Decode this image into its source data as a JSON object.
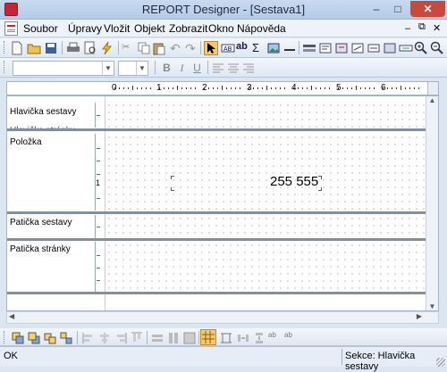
{
  "window": {
    "title": "REPORT Designer - [Sestava1]"
  },
  "menubar": {
    "items": [
      {
        "label": "Soubor"
      },
      {
        "label": "Úpravy"
      },
      {
        "label": "Vložit"
      },
      {
        "label": "Objekt"
      },
      {
        "label": "Zobrazit"
      },
      {
        "label": "Okno"
      },
      {
        "label": "Nápověda"
      }
    ]
  },
  "format_toolbar": {
    "font_value": "",
    "size_value": "",
    "bold": "B",
    "italic": "I",
    "underline": "U"
  },
  "ruler": {
    "numbers": [
      "0",
      "1",
      "2",
      "3",
      "4",
      "5",
      "6"
    ]
  },
  "bands": [
    {
      "label": "Hlavička sestavy"
    },
    {
      "label": "Položka"
    },
    {
      "label": "Patička sestavy"
    },
    {
      "label": "Patička stránky"
    }
  ],
  "band_cut_label": "Hlavička stránky",
  "item_band_marker": "1",
  "field_value": "255 555",
  "status": {
    "left": "OK",
    "right": "Sekce: Hlavička sestavy"
  },
  "colors": {
    "close_button": "#c94a3b",
    "selection_handle": "#d03020"
  }
}
